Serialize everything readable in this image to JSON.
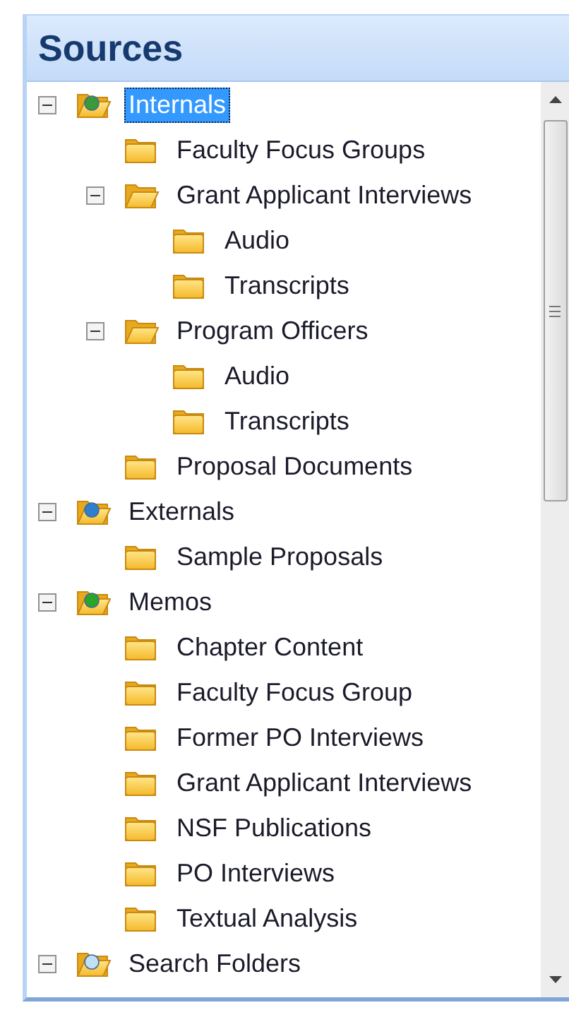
{
  "panel": {
    "title": "Sources"
  },
  "tree": [
    {
      "label": "Internals",
      "kind": "internals-folder",
      "selected": true,
      "expanded": true,
      "children": [
        {
          "label": "Faculty Focus Groups",
          "kind": "folder",
          "selected": false
        },
        {
          "label": "Grant Applicant Interviews",
          "kind": "folder",
          "selected": false,
          "expanded": true,
          "children": [
            {
              "label": "Audio",
              "kind": "folder",
              "selected": false
            },
            {
              "label": "Transcripts",
              "kind": "folder",
              "selected": false
            }
          ]
        },
        {
          "label": "Program Officers",
          "kind": "folder",
          "selected": false,
          "expanded": true,
          "children": [
            {
              "label": "Audio",
              "kind": "folder",
              "selected": false
            },
            {
              "label": "Transcripts",
              "kind": "folder",
              "selected": false
            }
          ]
        },
        {
          "label": "Proposal Documents",
          "kind": "folder",
          "selected": false
        }
      ]
    },
    {
      "label": "Externals",
      "kind": "externals-folder",
      "selected": false,
      "expanded": true,
      "children": [
        {
          "label": "Sample Proposals",
          "kind": "folder",
          "selected": false
        }
      ]
    },
    {
      "label": "Memos",
      "kind": "memos-folder",
      "selected": false,
      "expanded": true,
      "children": [
        {
          "label": "Chapter Content",
          "kind": "folder",
          "selected": false
        },
        {
          "label": "Faculty Focus Group",
          "kind": "folder",
          "selected": false
        },
        {
          "label": "Former PO Interviews",
          "kind": "folder",
          "selected": false
        },
        {
          "label": "Grant Applicant Interviews",
          "kind": "folder",
          "selected": false
        },
        {
          "label": "NSF Publications",
          "kind": "folder",
          "selected": false
        },
        {
          "label": "PO Interviews",
          "kind": "folder",
          "selected": false
        },
        {
          "label": "Textual Analysis",
          "kind": "folder",
          "selected": false
        }
      ]
    },
    {
      "label": "Search Folders",
      "kind": "search-folder",
      "selected": false,
      "expanded": true
    }
  ]
}
